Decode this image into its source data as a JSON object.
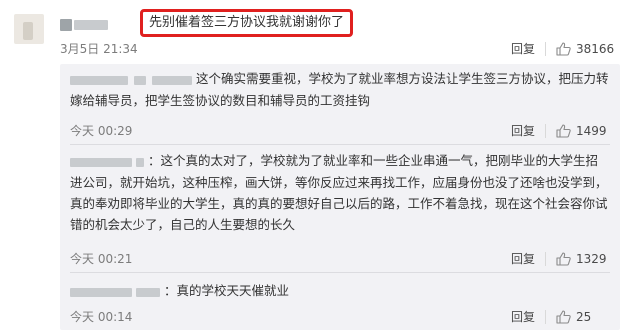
{
  "main": {
    "text": "先别催着签三方协议我就谢谢你了",
    "time": "3月5日 21:34",
    "reply_label": "回复",
    "like_count": "38166"
  },
  "replies": [
    {
      "text": "这个确实需要重视，学校为了就业率想方设法让学生签三方协议，把压力转嫁给辅导员，把学生签协议的数目和辅导员的工资挂钩",
      "time": "今天 00:29",
      "reply_label": "回复",
      "like_count": "1499"
    },
    {
      "text": "：这个真的太对了，学校就为了就业率和一些企业串通一气，把刚毕业的大学生招进公司，就开始坑，这种压榨，画大饼，等你反应过来再找工作，应届身份也没了还啥也没学到，真的奉劝即将毕业的大学生，真的真的要想好自己以后的路，工作不着急找，现在这个社会容你试错的机会太少了，自己的人生要想的长久",
      "time": "今天 00:21",
      "reply_label": "回复",
      "like_count": "1329"
    },
    {
      "text": "：真的学校天天催就业",
      "time": "今天 00:14",
      "reply_label": "回复",
      "like_count": "25"
    }
  ],
  "icons": {
    "like": "thumbs-up-icon",
    "avatar": "blurred-avatar"
  },
  "colors": {
    "highlight_border": "#e0201f",
    "panel_bg": "#f2f2f5",
    "time_text": "#7c7c7c"
  }
}
